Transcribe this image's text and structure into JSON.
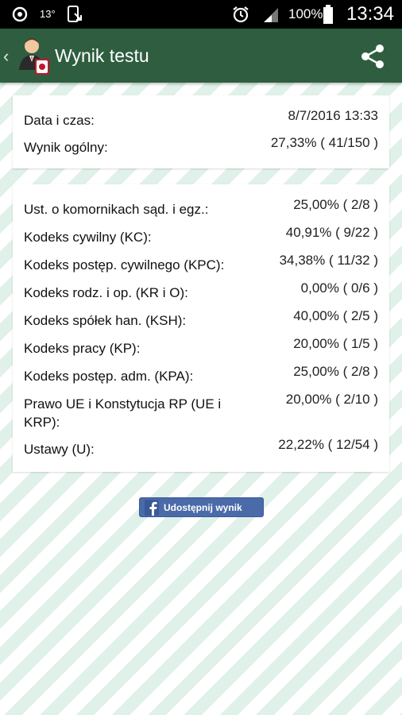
{
  "status_bar": {
    "temperature": "13°",
    "battery": "100%",
    "time": "13:34"
  },
  "app_bar": {
    "title": "Wynik testu"
  },
  "summary": [
    {
      "label": "Data i czas:",
      "value": "8/7/2016 13:33"
    },
    {
      "label": "Wynik ogólny:",
      "value": "27,33% ( 41/150 )"
    }
  ],
  "categories": [
    {
      "label": "Ust. o komornikach sąd. i egz.:",
      "value": "25,00% ( 2/8 )"
    },
    {
      "label": "Kodeks cywilny (KC):",
      "value": "40,91% ( 9/22 )"
    },
    {
      "label": "Kodeks postęp. cywilnego (KPC):",
      "value": "34,38% ( 11/32 )"
    },
    {
      "label": "Kodeks rodz. i op. (KR i O):",
      "value": "0,00% ( 0/6 )"
    },
    {
      "label": "Kodeks spółek han. (KSH):",
      "value": "40,00% ( 2/5 )"
    },
    {
      "label": "Kodeks pracy (KP):",
      "value": "20,00% ( 1/5 )"
    },
    {
      "label": "Kodeks postęp. adm. (KPA):",
      "value": "25,00% ( 2/8 )"
    },
    {
      "label": "Prawo UE i Konstytucja RP (UE i",
      "label2": "KRP):",
      "value": "20,00% ( 2/10 )"
    },
    {
      "label": "Ustawy (U):",
      "value": "22,22% ( 12/54 )"
    }
  ],
  "share_button": {
    "label": "Udostępnij wynik"
  },
  "colors": {
    "app_bar": "#2e5e3f",
    "stripe": "#dff1e8",
    "facebook": "#4a6aa9"
  }
}
